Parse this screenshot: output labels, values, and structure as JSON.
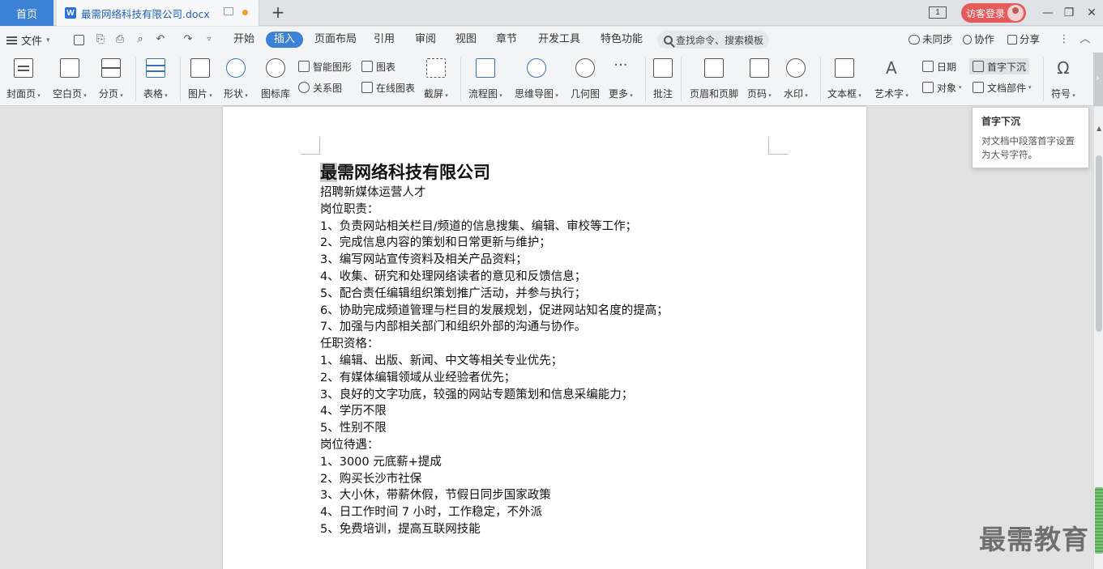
{
  "titlebar": {
    "home_tab": "首页",
    "doc_tab_title": "最需网络科技有限公司.docx",
    "login_label": "访客登录",
    "page_indicator": "1"
  },
  "menubar": {
    "file_label": "文件",
    "tabs": [
      "开始",
      "插入",
      "页面布局",
      "引用",
      "审阅",
      "视图",
      "章节",
      "开发工具",
      "特色功能"
    ],
    "active_tab": "插入",
    "search_placeholder": "查找命令、搜索模板",
    "sync_label": "未同步",
    "collab_label": "协作",
    "share_label": "分享"
  },
  "ribbon": {
    "cover_page": "封面页",
    "blank_page": "空白页",
    "page_break": "分页",
    "table": "表格",
    "picture": "图片",
    "shape": "形状",
    "icon_lib": "图标库",
    "smart_shape": "智能图形",
    "chart": "图表",
    "relation_chart": "关系图",
    "online_chart": "在线图表",
    "screenshot": "截屏",
    "flowchart": "流程图",
    "mindmap": "思维导图",
    "geometry": "几何图",
    "more": "更多",
    "comment": "批注",
    "header_footer": "页眉和页脚",
    "page_number": "页码",
    "watermark": "水印",
    "textbox": "文本框",
    "wordart": "艺术字",
    "date": "日期",
    "object": "对象",
    "drop_cap": "首字下沉",
    "doc_parts": "文档部件",
    "symbol": "符号"
  },
  "tooltip": {
    "title": "首字下沉",
    "body": "对文档中段落首字设置为大号字符。"
  },
  "document": {
    "heading_first": "最",
    "heading_rest": "需网络科技有限公司",
    "lines": [
      "招聘新媒体运营人才",
      "岗位职责：",
      "1、负责网站相关栏目/频道的信息搜集、编辑、审校等工作；",
      "2、完成信息内容的策划和日常更新与维护；",
      "3、编写网站宣传资料及相关产品资料；",
      "4、收集、研究和处理网络读者的意见和反馈信息；",
      "5、配合责任编辑组织策划推广活动，并参与执行；",
      "6、协助完成频道管理与栏目的发展规划，促进网站知名度的提高；",
      "7、加强与内部相关部门和组织外部的沟通与协作。",
      "任职资格：",
      "1、编辑、出版、新闻、中文等相关专业优先；",
      "2、有媒体编辑领域从业经验者优先；",
      "3、良好的文字功底，较强的网站专题策划和信息采编能力；",
      "4、学历不限",
      "5、性别不限",
      "岗位待遇：",
      "1、3000 元底薪+提成",
      "2、购买长沙市社保",
      "3、大小休，带薪休假，节假日同步国家政策",
      "4、日工作时间 7 小时，工作稳定，不外派",
      "5、免费培训，提高互联网技能"
    ]
  },
  "watermark_text": "最需教育",
  "colors": {
    "accent": "#3b82d6",
    "login": "#e55b5b",
    "unsaved_dot": "#f29e2e"
  }
}
